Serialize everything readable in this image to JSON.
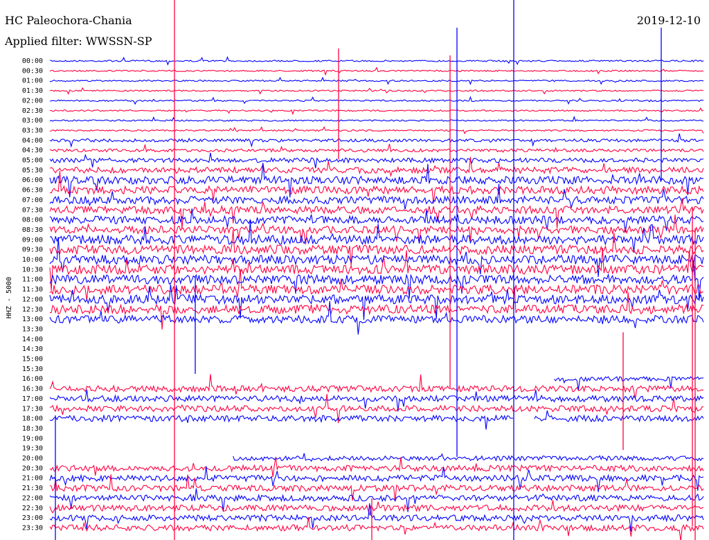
{
  "header": {
    "station": "HC Paleochora-Chania",
    "date": "2019-12-10",
    "filter": "Applied filter: WWSSN-SP"
  },
  "chart_data": {
    "type": "line",
    "title": "HC Paleochora-Chania",
    "ylabel": "HHZ - 5000",
    "rows": [
      "00:00",
      "00:30",
      "01:00",
      "01:30",
      "02:00",
      "02:30",
      "03:00",
      "03:30",
      "04:00",
      "04:30",
      "05:00",
      "05:30",
      "06:00",
      "06:30",
      "07:00",
      "07:30",
      "08:00",
      "08:30",
      "09:00",
      "09:30",
      "10:00",
      "10:30",
      "11:00",
      "11:30",
      "12:00",
      "12:30",
      "13:00",
      "13:30",
      "14:00",
      "14:30",
      "15:00",
      "15:30",
      "16:00",
      "16:30",
      "17:00",
      "17:30",
      "18:00",
      "18:30",
      "19:00",
      "19:30",
      "20:00",
      "20:30",
      "21:00",
      "21:30",
      "22:00",
      "22:30",
      "23:00",
      "23:30"
    ],
    "row_colors": [
      "#0000ff",
      "#ff0040"
    ],
    "noise_level": [
      1,
      1,
      1,
      1,
      1,
      1,
      1,
      1,
      2,
      2,
      3,
      4,
      5,
      5,
      5,
      5,
      5,
      5,
      6,
      6,
      6,
      6,
      6,
      6,
      6,
      6,
      5,
      0,
      0,
      0,
      0,
      0,
      3,
      4,
      4,
      4,
      4,
      0,
      0,
      0,
      3,
      4,
      4,
      4,
      4,
      4,
      4,
      4
    ],
    "gaps": [
      {
        "row": "16:00",
        "from": 0,
        "to": 0.77
      },
      {
        "row": "18:00",
        "from": 0.71,
        "to": 0.74
      },
      {
        "row": "20:00",
        "from": 0,
        "to": 0.28
      }
    ],
    "grid": false
  }
}
